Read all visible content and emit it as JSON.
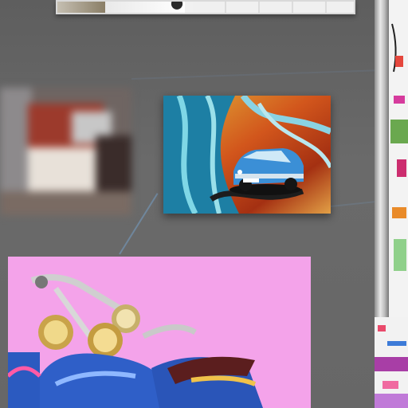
{
  "scene": {
    "description_role": "artwork-gallery-wall",
    "colors": {
      "wall": "#666666",
      "scooter_background": "#f4a3ea",
      "rail": "#bdbdbd",
      "glow": "#78aadc"
    }
  },
  "artworks": [
    {
      "id": "top-strip",
      "name": "top-shelf-artwork-strip"
    },
    {
      "id": "blurred",
      "name": "blurred-artwork-thumbnail"
    },
    {
      "id": "car",
      "name": "blue-car-painting"
    },
    {
      "id": "scooter",
      "name": "blue-scooter-painting"
    },
    {
      "id": "right-panel",
      "name": "right-edge-artwork"
    }
  ]
}
